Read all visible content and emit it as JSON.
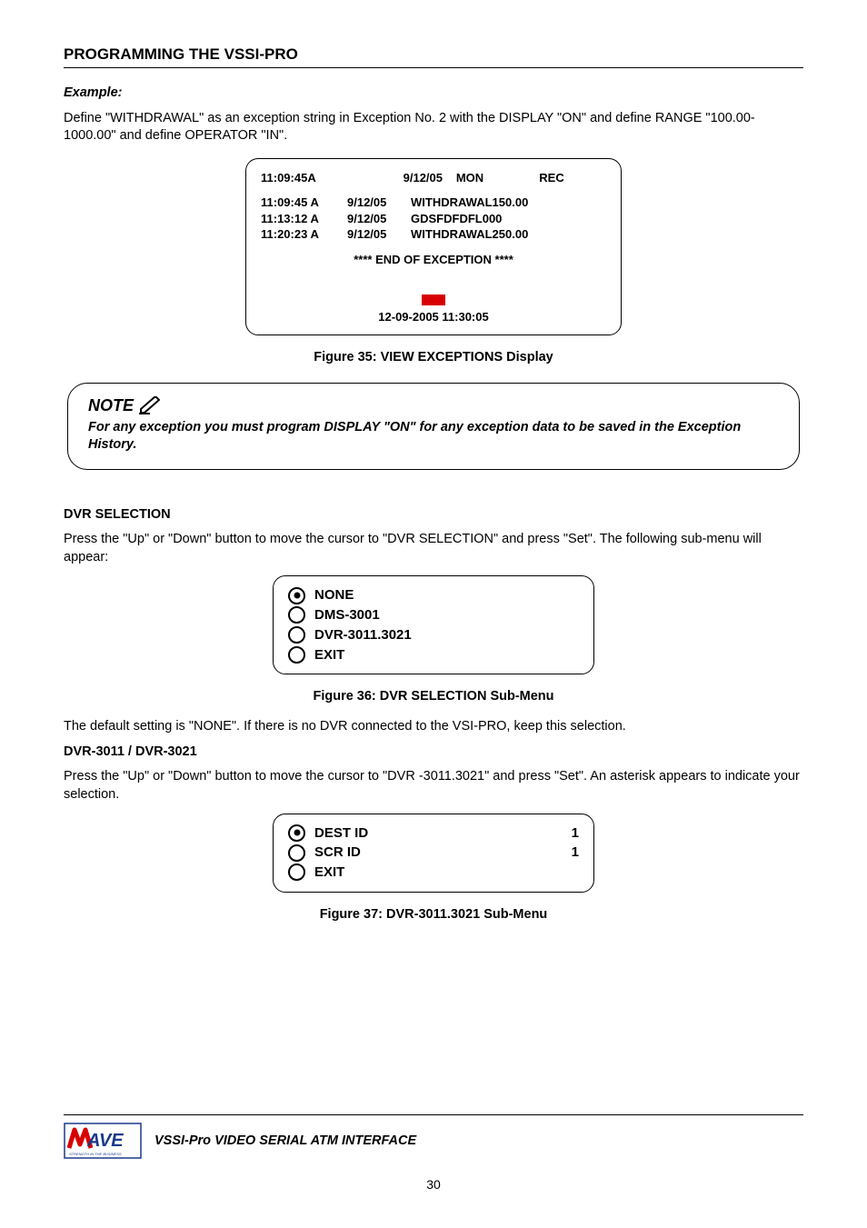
{
  "section_title": "PROGRAMMING THE VSSI-PRO",
  "example_label": "Example:",
  "example_text": "Define \"WITHDRAWAL\" as an exception string in Exception No. 2 with the DISPLAY \"ON\" and define RANGE \"100.00-1000.00\" and define OPERATOR \"IN\".",
  "screen": {
    "hdr_time": "11:09:45A",
    "hdr_date": "9/12/05",
    "hdr_mon": "MON",
    "hdr_rec": "REC",
    "rows": [
      {
        "t": "11:09:45 A",
        "d": "9/12/05",
        "v": "WITHDRAWAL150.00"
      },
      {
        "t": "11:13:12 A",
        "d": "9/12/05",
        "v": "GDSFDFDFL000"
      },
      {
        "t": "11:20:23 A",
        "d": "9/12/05",
        "v": "WITHDRAWAL250.00"
      }
    ],
    "end_line": "**** END OF EXCEPTION ****",
    "stamp": "12-09-2005  11:30:05"
  },
  "fig35": "Figure 35: VIEW EXCEPTIONS Display",
  "note_title": "NOTE",
  "note_body": "For any exception you must program DISPLAY \"ON\" for any exception data to be saved in the Exception History.",
  "dvr_sel_heading": "DVR SELECTION",
  "dvr_sel_text": "Press the \"Up\" or \"Down\" button to move the cursor to \"DVR SELECTION\" and press \"Set\". The following sub-menu will appear:",
  "menu1": {
    "items": [
      "NONE",
      "DMS-3001",
      "DVR-3011.3021",
      "EXIT"
    ]
  },
  "fig36": "Figure 36: DVR SELECTION Sub-Menu",
  "default_text": "The default setting is \"NONE\".  If there is no DVR connected to the VSI-PRO, keep this selection.",
  "dvr3011_heading": "DVR-3011 / DVR-3021",
  "dvr3011_text": "Press the \"Up\" or \"Down\" button to move the cursor to \"DVR -3011.3021\" and press \"Set\". An asterisk appears to indicate your selection.",
  "menu2": {
    "items": [
      {
        "label": "DEST ID",
        "val": "1"
      },
      {
        "label": "SCR  ID",
        "val": "1"
      },
      {
        "label": "EXIT",
        "val": ""
      }
    ]
  },
  "fig37": "Figure 37: DVR-3011.3021 Sub-Menu",
  "footer_text": "VSSI-Pro VIDEO SERIAL ATM INTERFACE",
  "page_number": "30"
}
